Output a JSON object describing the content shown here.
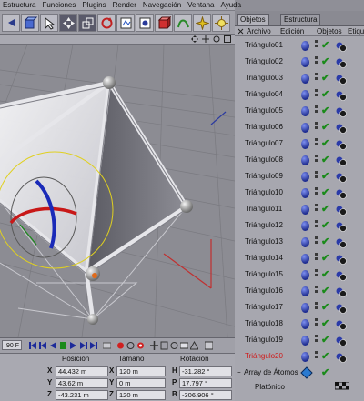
{
  "menu": [
    "Estructura",
    "Funciones",
    "Plugins",
    "Render",
    "Navegación",
    "Ventana",
    "Ayuda"
  ],
  "tabs": {
    "objects": "Objetos",
    "structure": "Estructura"
  },
  "object_manager_menu": [
    "Archivo",
    "Edición",
    "Objetos",
    "Etiqu"
  ],
  "objects": [
    {
      "name": "Triángulo01",
      "selected": false
    },
    {
      "name": "Triángulo02",
      "selected": false
    },
    {
      "name": "Triángulo03",
      "selected": false
    },
    {
      "name": "Triángulo04",
      "selected": false
    },
    {
      "name": "Triángulo05",
      "selected": false
    },
    {
      "name": "Triángulo06",
      "selected": false
    },
    {
      "name": "Triángulo07",
      "selected": false
    },
    {
      "name": "Triángulo08",
      "selected": false
    },
    {
      "name": "Triángulo09",
      "selected": false
    },
    {
      "name": "Triángulo10",
      "selected": false
    },
    {
      "name": "Triángulo11",
      "selected": false
    },
    {
      "name": "Triángulo12",
      "selected": false
    },
    {
      "name": "Triángulo13",
      "selected": false
    },
    {
      "name": "Triángulo14",
      "selected": false
    },
    {
      "name": "Triángulo15",
      "selected": false
    },
    {
      "name": "Triángulo16",
      "selected": false
    },
    {
      "name": "Triángulo17",
      "selected": false
    },
    {
      "name": "Triángulo18",
      "selected": false
    },
    {
      "name": "Triángulo19",
      "selected": false
    },
    {
      "name": "Triángulo20",
      "selected": true
    }
  ],
  "hierarchy": {
    "parent": "Array de Átomos",
    "child": "Platónico"
  },
  "timeline": {
    "frame": "90 F"
  },
  "coordinates": {
    "headers": {
      "position": "Posición",
      "size": "Tamaño",
      "rotation": "Rotación"
    },
    "rows": [
      {
        "axis": "X",
        "position": "44.432 m",
        "size": "120 m",
        "rot_axis": "H",
        "rotation": "-31.282 °"
      },
      {
        "axis": "Y",
        "position": "43.62 m",
        "size": "0 m",
        "rot_axis": "P",
        "rotation": "17.797 °"
      },
      {
        "axis": "Z",
        "position": "-43.231 m",
        "size": "120 m",
        "rot_axis": "B",
        "rotation": "-306.906 °"
      }
    ]
  },
  "colors": {
    "selected_object": "#d01a1a",
    "check": "#1a8a1a",
    "layer_dot": "#2a3aa8"
  }
}
